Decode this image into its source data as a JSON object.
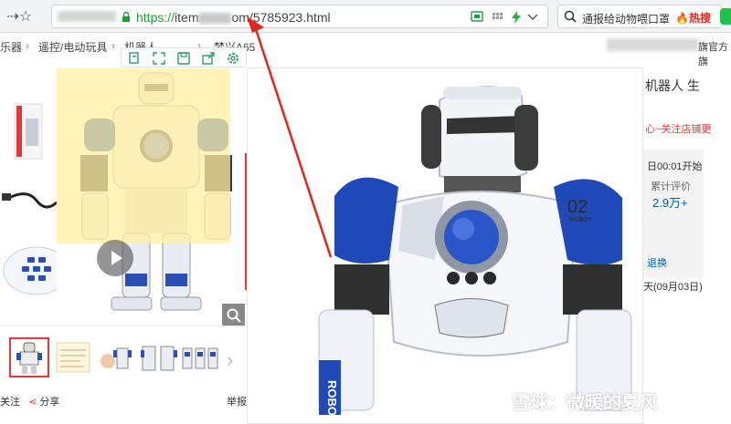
{
  "browser": {
    "url_scheme": "https://",
    "url_host_visible": "item",
    "url_host_tail": "om",
    "url_path": "/5785923.html",
    "search_text": "通报给动物喂口罩",
    "hot_label": "热搜"
  },
  "breadcrumb": {
    "items": [
      "乐器",
      "遥控/电动玩具",
      "机器人",
      "梦兴(xing)",
      "梦兴A65"
    ]
  },
  "image_toolbar": {
    "icons": [
      "copy-icon",
      "fullscreen-icon",
      "save-icon",
      "share-icon",
      "settings-icon"
    ]
  },
  "gallery": {
    "share_label": "分享",
    "follow_label": "关注",
    "report_label": "举报"
  },
  "right_panel": {
    "title_fragment": "机器人 生",
    "shop_note": "心~关注店铺更",
    "store_fragment": "旗官方旗",
    "time_fragment": "日00:01开始",
    "rating_label": "累计评价",
    "rating_value": "2.9万+",
    "refund_label": "退换",
    "delivery_fragment": "天(09月03日)"
  },
  "robot": {
    "model_badge": "02",
    "sub_badge": "ROBOT",
    "arm_text": "ROBO"
  },
  "watermark": {
    "text": "雪球：微暖的夏风"
  },
  "colors": {
    "accent_red": "#e4393c",
    "link_blue": "#005ea7",
    "robot_blue": "#1f49b8",
    "url_green": "#1f9b3a",
    "lens_yellow": "#fff0a0"
  }
}
